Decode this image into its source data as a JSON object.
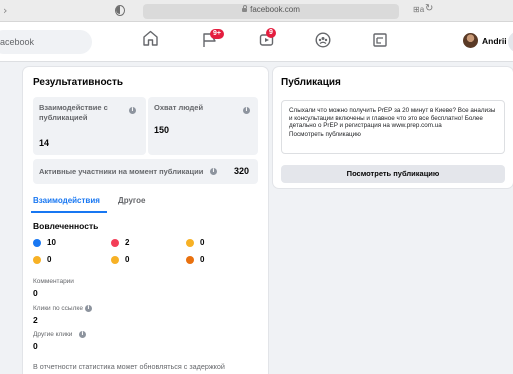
{
  "browser": {
    "url": "facebook.com"
  },
  "nav": {
    "search_placeholder": "acebook",
    "notifications_badge": "9+",
    "video_badge": "9",
    "user_name": "Andrii"
  },
  "performance": {
    "title": "Результативность",
    "engagement_label": "Взаимодействие с публикацией",
    "engagement_value": "14",
    "reach_label": "Охват людей",
    "reach_value": "150",
    "active_label": "Активные участники на момент публикации",
    "active_value": "320",
    "tabs": [
      {
        "label": "Взаимодействия",
        "active": true
      },
      {
        "label": "Другое",
        "active": false
      }
    ],
    "involvement_title": "Вовлеченность",
    "reactions": [
      {
        "icon": "like-icon",
        "count": "10",
        "color": "#1877f2"
      },
      {
        "icon": "love-icon",
        "count": "2",
        "color": "#f33e58"
      },
      {
        "icon": "haha-icon",
        "count": "0",
        "color": "#f7b125"
      },
      {
        "icon": "wow-icon",
        "count": "0",
        "color": "#f7b125"
      },
      {
        "icon": "sad-icon",
        "count": "0",
        "color": "#f7b125"
      },
      {
        "icon": "angry-icon",
        "count": "0",
        "color": "#e9710f"
      }
    ],
    "comments_label": "Комментарии",
    "comments_value": "0",
    "link_clicks_label": "Клики по ссылке",
    "link_clicks_value": "2",
    "other_clicks_label": "Другие клики",
    "other_clicks_value": "0",
    "footnote": "В отчетности статистика может обновляться с задержкой"
  },
  "publication": {
    "title": "Публикация",
    "text": "Слыхали что можно получить PrEP за 20 минут в Киеве? Все анализы и консультации включены и главное что это все бесплатно! Более детально о PrEP и регистрация на www.prep.com.ua",
    "view_link": "Посмотреть публикацию",
    "view_button": "Посмотреть публикацию"
  },
  "colors": {
    "accent": "#1877f2",
    "badge": "#e41e3f"
  }
}
